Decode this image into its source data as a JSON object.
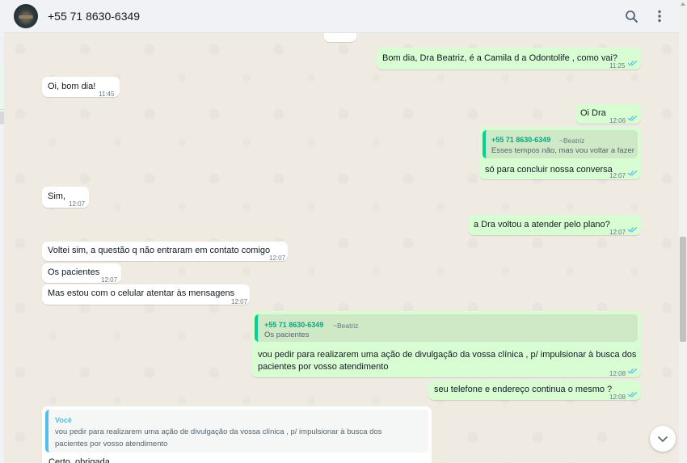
{
  "header": {
    "contact": "+55 71 8630-6349",
    "search_icon": "search-icon",
    "menu_icon": "kebab-menu-icon"
  },
  "colors": {
    "incoming": "#ffffff",
    "outgoing": "#d9fdd3",
    "quote_accent": "#06cf9c",
    "you_accent": "#53bdeb",
    "read_ticks": "#53bdeb"
  },
  "messages": [
    {
      "text": "Bom dia, Dra Beatriz, é a Camila d a Odontolife , como vai?",
      "time": "11:25"
    },
    {
      "text": "Oi, bom dia!",
      "time": "11:45"
    },
    {
      "text": "Oi Dra",
      "time": "12:06"
    },
    {
      "quote_author": "+55 71 8630-6349",
      "quote_sender": "~Beatriz",
      "quote_text": "Esses tempos não, mas vou voltar a fazer",
      "text": "só para concluir nossa conversa",
      "time": "12:07"
    },
    {
      "text": "Sim,",
      "time": "12:07"
    },
    {
      "text": "a Dra voltou a atender pelo plano?",
      "time": "12:07"
    },
    {
      "text": "Voltei sim, a questão q não entraram em contato comigo",
      "time": "12:07"
    },
    {
      "text": "Os pacientes",
      "time": "12:07"
    },
    {
      "text": "Mas estou com o celular atentar às mensagens",
      "time": "12:07"
    },
    {
      "quote_author": "+55 71 8630-6349",
      "quote_sender": "~Beatriz",
      "quote_text": "Os pacientes",
      "text_line1": "vou pedir para realizarem uma ação de divulgação da vossa clínica , p/ impulsionar à busca dos",
      "text_line2": "pacientes por vosso atendimento",
      "time": "12:08"
    },
    {
      "text": "seu telefone e endereço continua o mesmo ?",
      "time": "12:08"
    },
    {
      "quote_author": "Você",
      "quote_line1": "vou pedir para realizarem uma ação de divulgação da vossa clínica , p/ impulsionar à busca dos",
      "quote_line2": "pacientes por vosso atendimento",
      "text": "Certo, obrigada"
    }
  ]
}
